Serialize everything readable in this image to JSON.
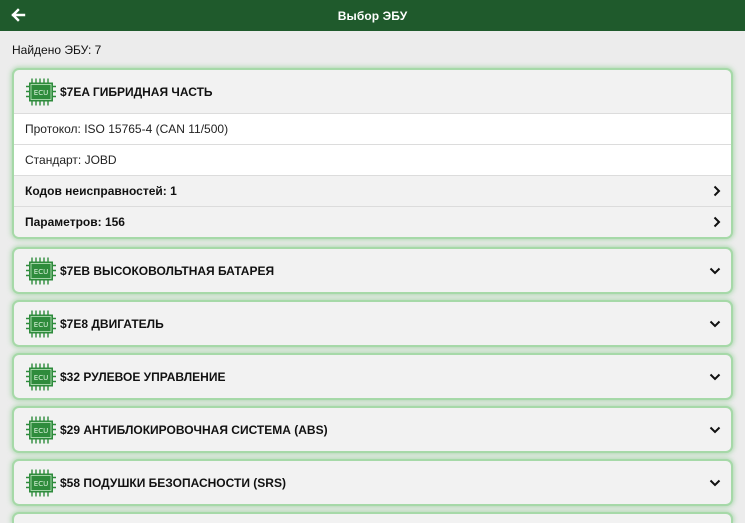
{
  "header": {
    "title": "Выбор ЭБУ",
    "back_icon": "arrow-left-icon"
  },
  "found_text": "Найдено ЭБУ: 7",
  "ecu_icon_label": "ECU",
  "colors": {
    "appbar": "#1f5a2c",
    "card_border": "#a6d9a8",
    "ecu_icon": "#2e8b3c"
  },
  "ecus": [
    {
      "name": "$7EA ГИБРИДНАЯ ЧАСТЬ",
      "expanded": true,
      "protocol": "Протокол: ISO 15765-4 (CAN 11/500)",
      "standard": "Стандарт: JOBD",
      "dtc_label": "Кодов неисправностей: 1",
      "params_label": "Параметров: 156"
    },
    {
      "name": "$7EB ВЫСОКОВОЛЬТНАЯ БАТАРЕЯ",
      "expanded": false
    },
    {
      "name": "$7E8 ДВИГАТЕЛЬ",
      "expanded": false
    },
    {
      "name": "$32 РУЛЕВОЕ УПРАВЛЕНИЕ",
      "expanded": false
    },
    {
      "name": "$29 АНТИБЛОКИРОВОЧНАЯ СИСТЕМА (ABS)",
      "expanded": false
    },
    {
      "name": "$58 ПОДУШКИ БЕЗОПАСНОСТИ (SRS)",
      "expanded": false
    }
  ]
}
